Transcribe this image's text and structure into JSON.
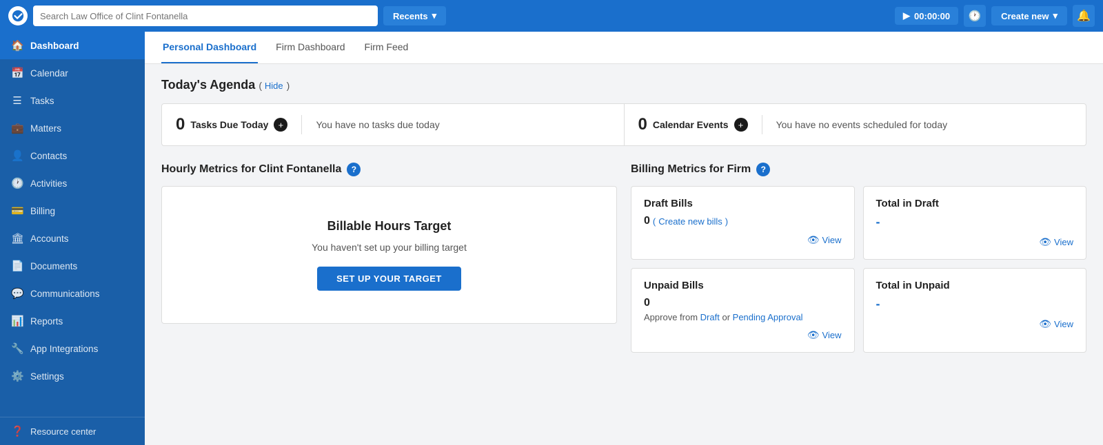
{
  "topnav": {
    "search_placeholder": "Search Law Office of Clint Fontanella",
    "recents_label": "Recents",
    "timer_label": "00:00:00",
    "create_label": "Create new"
  },
  "sidebar": {
    "items": [
      {
        "id": "dashboard",
        "label": "Dashboard",
        "icon": "🏠",
        "active": true
      },
      {
        "id": "calendar",
        "label": "Calendar",
        "icon": "📅"
      },
      {
        "id": "tasks",
        "label": "Tasks",
        "icon": "☰"
      },
      {
        "id": "matters",
        "label": "Matters",
        "icon": "💼"
      },
      {
        "id": "contacts",
        "label": "Contacts",
        "icon": "👤"
      },
      {
        "id": "activities",
        "label": "Activities",
        "icon": "🕐"
      },
      {
        "id": "billing",
        "label": "Billing",
        "icon": "💳"
      },
      {
        "id": "accounts",
        "label": "Accounts",
        "icon": "🏛"
      },
      {
        "id": "documents",
        "label": "Documents",
        "icon": "📄"
      },
      {
        "id": "communications",
        "label": "Communications",
        "icon": "💬"
      },
      {
        "id": "reports",
        "label": "Reports",
        "icon": "📊"
      },
      {
        "id": "app-integrations",
        "label": "App Integrations",
        "icon": "🔧"
      },
      {
        "id": "settings",
        "label": "Settings",
        "icon": "⚙️"
      }
    ],
    "bottom_item": {
      "id": "resource-center",
      "label": "Resource center",
      "icon": "❓"
    }
  },
  "tabs": [
    {
      "id": "personal",
      "label": "Personal Dashboard",
      "active": true
    },
    {
      "id": "firm",
      "label": "Firm Dashboard",
      "active": false
    },
    {
      "id": "feed",
      "label": "Firm Feed",
      "active": false
    }
  ],
  "agenda": {
    "section_title": "Today's Agenda",
    "hide_label": "Hide",
    "tasks": {
      "count": "0",
      "label": "Tasks Due Today",
      "no_items_text": "You have no tasks due today"
    },
    "events": {
      "count": "0",
      "label": "Calendar Events",
      "no_items_text": "You have no events scheduled for today"
    }
  },
  "hourly_metrics": {
    "section_title": "Hourly Metrics for Clint Fontanella",
    "card": {
      "title": "Billable Hours Target",
      "subtitle": "You haven't set up your billing target",
      "button_label": "SET UP YOUR TARGET"
    }
  },
  "billing_metrics": {
    "section_title": "Billing Metrics for Firm",
    "draft_bills": {
      "title": "Draft Bills",
      "count": "0",
      "create_link": "Create new bills",
      "view_label": "View"
    },
    "total_draft": {
      "title": "Total in Draft",
      "value": "-",
      "view_label": "View"
    },
    "unpaid_bills": {
      "title": "Unpaid Bills",
      "count": "0",
      "approve_text": "Approve from",
      "draft_link": "Draft",
      "or_text": "or",
      "pending_link": "Pending Approval",
      "view_label": "View"
    },
    "total_unpaid": {
      "title": "Total in Unpaid",
      "value": "-",
      "view_label": "View"
    }
  }
}
